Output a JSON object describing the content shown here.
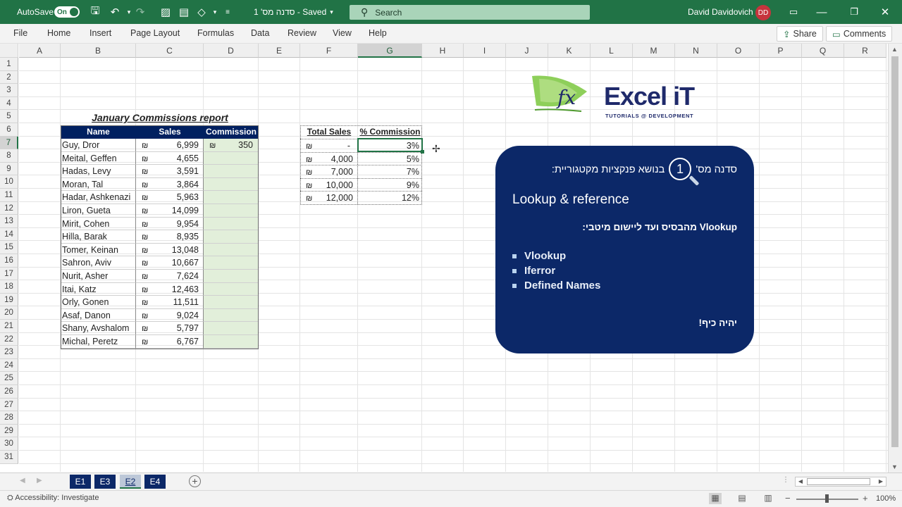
{
  "titlebar": {
    "autosave_label": "AutoSave",
    "autosave_state": "On",
    "doc_title": "סדנה מס' 1  -  Saved",
    "search_placeholder": "Search",
    "user_name": "David Davidovich",
    "user_initials": "DD"
  },
  "ribbon": {
    "tabs": [
      "File",
      "Home",
      "Insert",
      "Page Layout",
      "Formulas",
      "Data",
      "Review",
      "View",
      "Help"
    ],
    "share_label": "Share",
    "comments_label": "Comments"
  },
  "grid": {
    "columns": [
      "A",
      "B",
      "C",
      "D",
      "E",
      "F",
      "G",
      "H",
      "I",
      "J",
      "K",
      "L",
      "M",
      "N",
      "O",
      "P",
      "Q",
      "R"
    ],
    "rows": [
      "1",
      "2",
      "3",
      "4",
      "5",
      "6",
      "7",
      "8",
      "9",
      "10",
      "11",
      "12",
      "13",
      "14",
      "15",
      "16",
      "17",
      "18",
      "19",
      "20",
      "21",
      "22",
      "23",
      "24",
      "25",
      "26",
      "27",
      "28",
      "29",
      "30",
      "31"
    ],
    "selected_column": "G",
    "selected_row": "7"
  },
  "report": {
    "title": "January Commissions report",
    "headers": [
      "Name",
      "Sales",
      "Commission"
    ],
    "currency": "₪",
    "rows": [
      {
        "name": "Guy, Dror",
        "sales": "6,999",
        "commission": "350"
      },
      {
        "name": "Meital, Geffen",
        "sales": "4,655",
        "commission": ""
      },
      {
        "name": "Hadas, Levy",
        "sales": "3,591",
        "commission": ""
      },
      {
        "name": "Moran, Tal",
        "sales": "3,864",
        "commission": ""
      },
      {
        "name": "Hadar, Ashkenazi",
        "sales": "5,963",
        "commission": ""
      },
      {
        "name": "Liron, Gueta",
        "sales": "14,099",
        "commission": ""
      },
      {
        "name": "Mirit, Cohen",
        "sales": "9,954",
        "commission": ""
      },
      {
        "name": "Hilla, Barak",
        "sales": "8,935",
        "commission": ""
      },
      {
        "name": "Tomer, Keinan",
        "sales": "13,048",
        "commission": ""
      },
      {
        "name": "Sahron, Aviv",
        "sales": "10,667",
        "commission": ""
      },
      {
        "name": "Nurit, Asher",
        "sales": "7,624",
        "commission": ""
      },
      {
        "name": "Itai, Katz",
        "sales": "12,463",
        "commission": ""
      },
      {
        "name": "Orly, Gonen",
        "sales": "11,511",
        "commission": ""
      },
      {
        "name": "Asaf, Danon",
        "sales": "9,024",
        "commission": ""
      },
      {
        "name": "Shany, Avshalom",
        "sales": "5,797",
        "commission": ""
      },
      {
        "name": "Michal, Peretz",
        "sales": "6,767",
        "commission": ""
      }
    ]
  },
  "lookup_table": {
    "headers": [
      "Total Sales",
      "% Commission"
    ],
    "rows": [
      {
        "sales": "-",
        "pct": "3%"
      },
      {
        "sales": "4,000",
        "pct": "5%"
      },
      {
        "sales": "7,000",
        "pct": "7%"
      },
      {
        "sales": "10,000",
        "pct": "9%"
      },
      {
        "sales": "12,000",
        "pct": "12%"
      }
    ]
  },
  "logo": {
    "text_main": "Excel",
    "text_accent": " iT",
    "subtitle": "TUTORIALS @ DEVELOPMENT",
    "mark": "fx"
  },
  "card": {
    "title_before": "סדנה מס'",
    "number": "1",
    "title_after": "בנושא פנקציות מקטגוריית:",
    "lookup_title": "Lookup & reference",
    "subtitle": "Vlookup מהבסיס ועד ליישום מיטבי:",
    "items": [
      "Vlookup",
      "Iferror",
      "Defined Names"
    ],
    "closing": "יהיה כיף!"
  },
  "sheets": {
    "tabs": [
      "E1",
      "E3",
      "E2",
      "E4"
    ],
    "active": "E2"
  },
  "status": {
    "accessibility": "Accessibility: Investigate",
    "zoom": "100%"
  },
  "colors": {
    "excel_green": "#217346",
    "header_navy": "#002060",
    "card_navy": "#0c2868",
    "commission_fill": "#e2efda"
  }
}
